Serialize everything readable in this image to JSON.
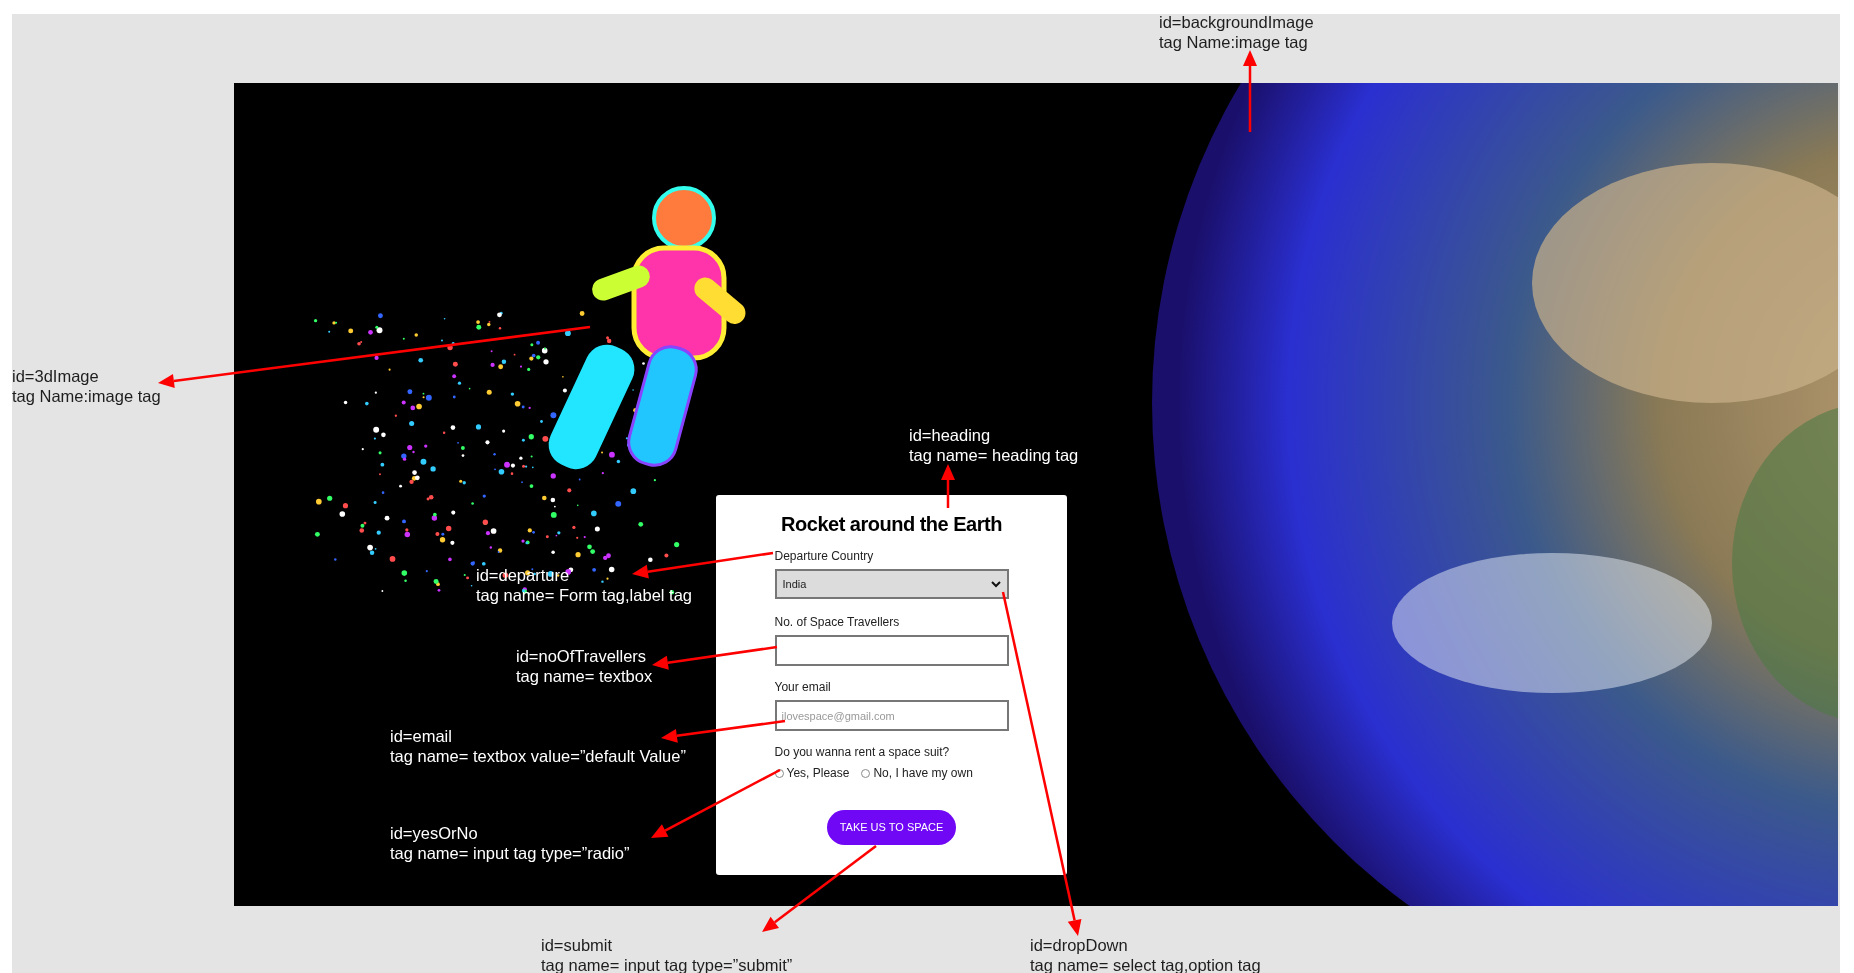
{
  "form": {
    "heading": "Rocket around the Earth",
    "fields": [
      {
        "kind": "select",
        "label": "Departure Country",
        "value": "India"
      },
      {
        "kind": "text",
        "label": "No. of Space Travellers"
      },
      {
        "kind": "text",
        "label": "Your email",
        "placeholder": "ilovespace@gmail.com"
      },
      {
        "kind": "radio",
        "label": "Do you wanna rent a space suit?",
        "options": [
          {
            "label": "Yes, Please",
            "selected": false
          },
          {
            "label": "No, I have my own",
            "selected": false
          }
        ]
      }
    ],
    "submit": "TAKE US TO SPACE"
  },
  "annotations": [
    {
      "lines": [
        "id=backgroundImage",
        "tag Name:image tag"
      ]
    },
    {
      "lines": [
        "id=3dImage",
        "tag Name:image tag"
      ]
    },
    {
      "lines": [
        "id=heading",
        "tag name= heading tag"
      ]
    },
    {
      "lines": [
        "id=departure",
        "tag name= Form tag,label tag"
      ]
    },
    {
      "lines": [
        "id=noOfTravellers",
        "tag name= textbox"
      ]
    },
    {
      "lines": [
        "id=email",
        "tag name= textbox value=”default Value”"
      ]
    },
    {
      "lines": [
        "id=yesOrNo",
        "tag name= input tag type=”radio”"
      ]
    },
    {
      "lines": [
        "id=submit",
        "tag name= input tag type=”submit”"
      ]
    },
    {
      "lines": [
        "id=dropDown",
        "tag name= select tag,option tag"
      ]
    }
  ]
}
